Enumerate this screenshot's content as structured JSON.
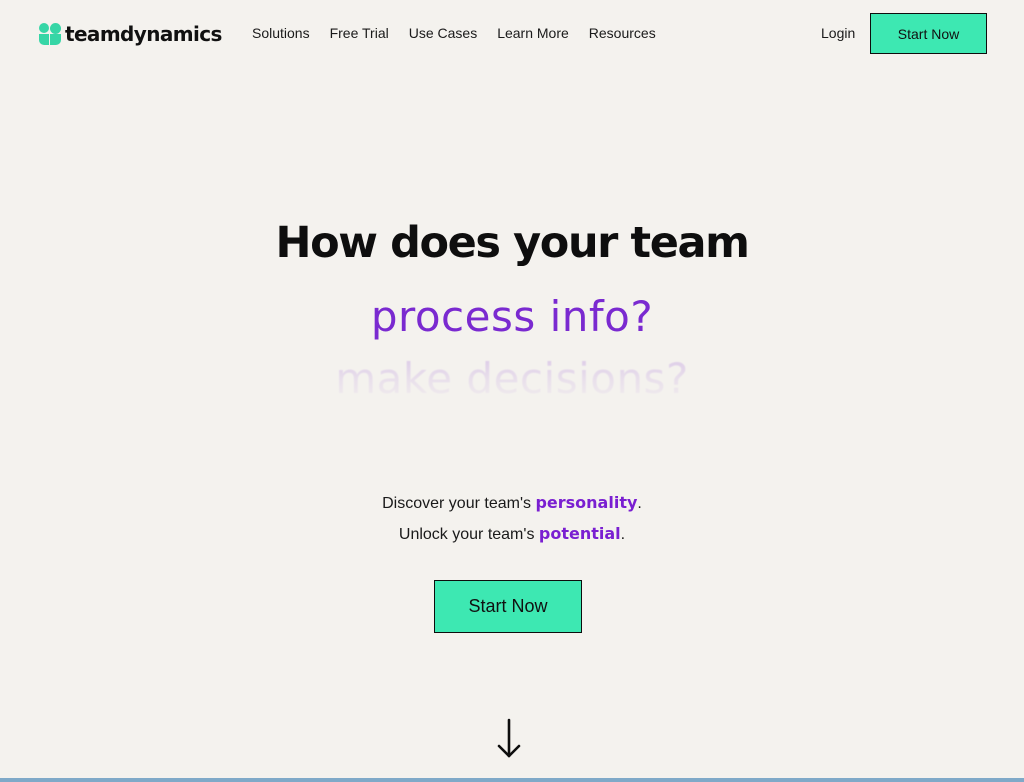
{
  "brand": {
    "name": "teamdynamics",
    "accent_color": "#3de8b2",
    "highlight_color": "#7a1fd1"
  },
  "nav": {
    "links": [
      "Solutions",
      "Free Trial",
      "Use Cases",
      "Learn More",
      "Resources"
    ],
    "login": "Login",
    "cta": "Start Now"
  },
  "hero": {
    "title": "How does your team",
    "rotating": [
      "process info?",
      "make decisions?"
    ],
    "line1_prefix": "Discover your team's ",
    "line1_accent": "personality",
    "line1_suffix": ".",
    "line2_prefix": "Unlock your team's ",
    "line2_accent": "potential",
    "line2_suffix": ".",
    "cta": "Start Now"
  },
  "icons": {
    "logo": "teamdynamics-logo-icon",
    "scroll": "arrow-down-icon"
  }
}
